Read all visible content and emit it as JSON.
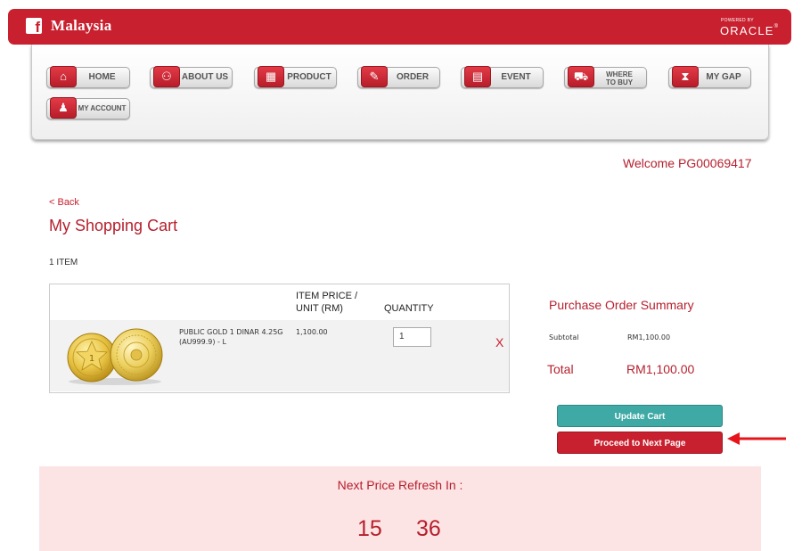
{
  "header": {
    "site_name": "Malaysia",
    "powered_by": "POWERED BY",
    "brand": "ORACLE",
    "brand_mark": "®",
    "accent_color": "#c8202f"
  },
  "nav": {
    "items": [
      {
        "label": "HOME",
        "icon": "home-icon",
        "glyph": "⌂"
      },
      {
        "label": "ABOUT US",
        "icon": "group-icon",
        "glyph": "⚇"
      },
      {
        "label": "PRODUCT",
        "icon": "gift-icon",
        "glyph": "▦"
      },
      {
        "label": "ORDER",
        "icon": "order-form-icon",
        "glyph": "✎"
      },
      {
        "label": "EVENT",
        "icon": "calendar-icon",
        "glyph": "▤"
      },
      {
        "label": "WHERE TO BUY",
        "label_line1": "WHERE",
        "label_line2": "TO BUY",
        "icon": "cart-icon",
        "glyph": "⛟"
      },
      {
        "label": "MY GAP",
        "icon": "hourglass-icon",
        "glyph": "⧗"
      },
      {
        "label": "MY ACCOUNT",
        "icon": "user-icon",
        "glyph": "♟"
      }
    ]
  },
  "welcome": "Welcome PG00069417",
  "back": "< Back",
  "page_title": "My Shopping Cart",
  "item_count": "1 ITEM",
  "cart": {
    "headers": {
      "price_line1": "ITEM PRICE /",
      "price_line2": "UNIT (RM)",
      "quantity": "QUANTITY"
    },
    "rows": [
      {
        "name_line1": "PUBLIC GOLD 1 DINAR 4.25G",
        "name_line2": "(AU999.9) - L",
        "price": "1,100.00",
        "quantity": "1",
        "remove": "X"
      }
    ]
  },
  "summary": {
    "title": "Purchase Order Summary",
    "subtotal_label": "Subtotal",
    "subtotal_value": "RM1,100.00",
    "total_label": "Total",
    "total_value": "RM1,100.00"
  },
  "buttons": {
    "update": "Update Cart",
    "next": "Proceed to Next Page"
  },
  "refresh": {
    "label": "Next Price Refresh In :",
    "minutes": "15",
    "seconds": "36"
  }
}
